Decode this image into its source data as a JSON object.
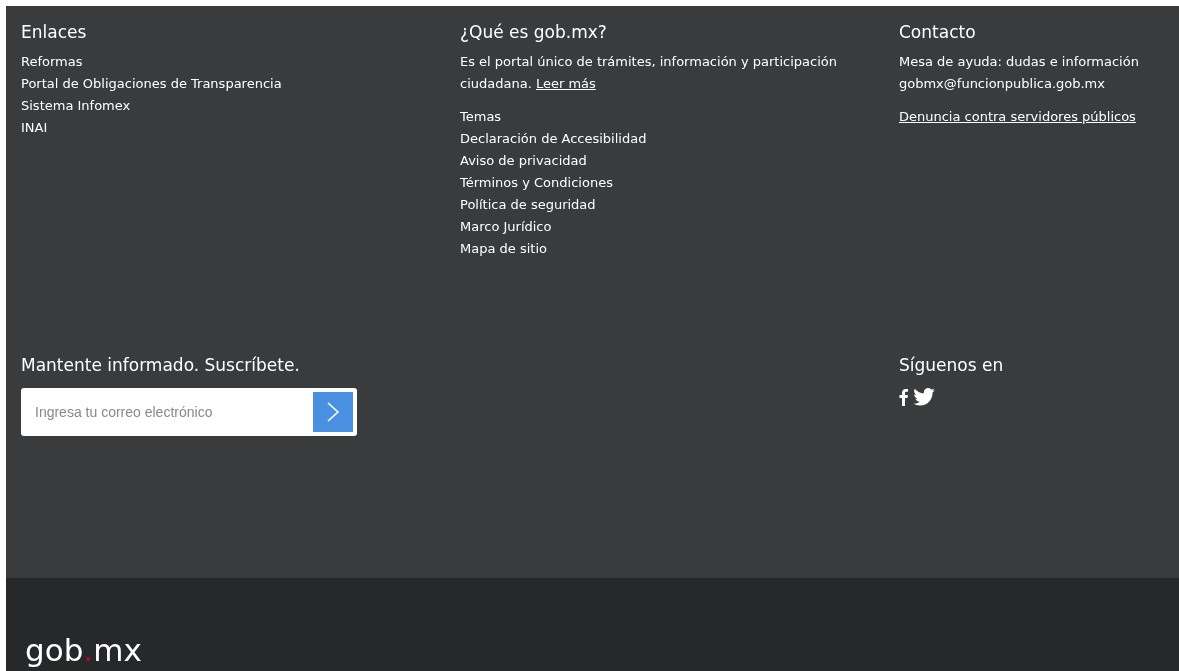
{
  "links": {
    "heading": "Enlaces",
    "items": [
      "Reformas",
      "Portal de Obligaciones de Transparencia",
      "Sistema Infomex",
      "INAI"
    ]
  },
  "about": {
    "heading": "¿Qué es gob.mx?",
    "text": "Es el portal único de trámites, información y participación ciudadana.",
    "more_link": "Leer más",
    "items": [
      "Temas",
      "Declaración de Accesibilidad",
      "Aviso de privacidad",
      "Términos y Condiciones",
      "Política de seguridad",
      "Marco Jurídico",
      "Mapa de sitio"
    ]
  },
  "contact": {
    "heading": "Contacto",
    "lines": [
      "Mesa de ayuda: dudas e información",
      "gobmx@funcionpublica.gob.mx"
    ],
    "link": "Denuncia contra servidores públicos"
  },
  "subscribe": {
    "heading": "Mantente informado. Suscríbete.",
    "placeholder": "Ingresa tu correo electrónico"
  },
  "social": {
    "heading": "Síguenos en",
    "networks": [
      {
        "kind": "facebook"
      },
      {
        "kind": "twitter"
      }
    ]
  },
  "logo": {
    "name": "gob",
    "dot": ".",
    "tld": "mx"
  }
}
